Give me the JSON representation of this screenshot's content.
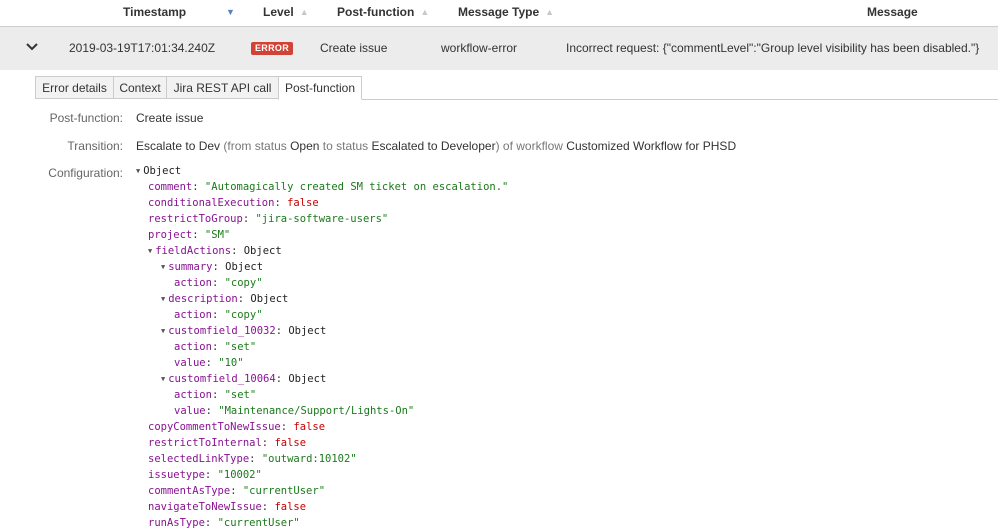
{
  "header": {
    "timestamp": "Timestamp",
    "level": "Level",
    "postfunction": "Post-function",
    "message_type": "Message Type",
    "message": "Message"
  },
  "row": {
    "timestamp": "2019-03-19T17:01:34.240Z",
    "level": "ERROR",
    "postfunction": "Create issue",
    "message_type": "workflow-error",
    "message": "Incorrect request: {\"commentLevel\":\"Group level visibility has been disabled.\"}"
  },
  "tabs": [
    "Error details",
    "Context",
    "Jira REST API call",
    "Post-function"
  ],
  "active_tab": "Post-function",
  "details": {
    "postfunction_label": "Post-function:",
    "postfunction_value": "Create issue",
    "transition_label": "Transition:",
    "transition": {
      "name": "Escalate to Dev",
      "from_prefix": "(from status",
      "from_status": "Open",
      "to_text": "to status",
      "to_status": "Escalated to Developer",
      "workflow_text": ") of workflow",
      "workflow": "Customized Workflow for PHSD"
    },
    "configuration_label": "Configuration:"
  },
  "config": {
    "root": "Object",
    "comment": "\"Automagically created SM ticket on escalation.\"",
    "conditionalExecution": "false",
    "restrictToGroup": "\"jira-software-users\"",
    "project": "\"SM\"",
    "fieldActions": "Object",
    "summary": "Object",
    "summary_action": "\"copy\"",
    "description": "Object",
    "description_action": "\"copy\"",
    "customfield_10032": "Object",
    "cf10032_action": "\"set\"",
    "cf10032_value": "\"10\"",
    "customfield_10064": "Object",
    "cf10064_action": "\"set\"",
    "cf10064_value": "\"Maintenance/Support/Lights-On\"",
    "copyCommentToNewIssue": "false",
    "restrictToInternal": "false",
    "selectedLinkType": "\"outward:10102\"",
    "issuetype": "\"10002\"",
    "commentAsType": "\"currentUser\"",
    "navigateToNewIssue": "false",
    "runAsType": "\"currentUser\""
  },
  "colors": {
    "error_badge": "#d04437",
    "key": "#881391",
    "string": "#1a7a1a",
    "boolean": "#c80000",
    "row_bg": "#ececec"
  }
}
